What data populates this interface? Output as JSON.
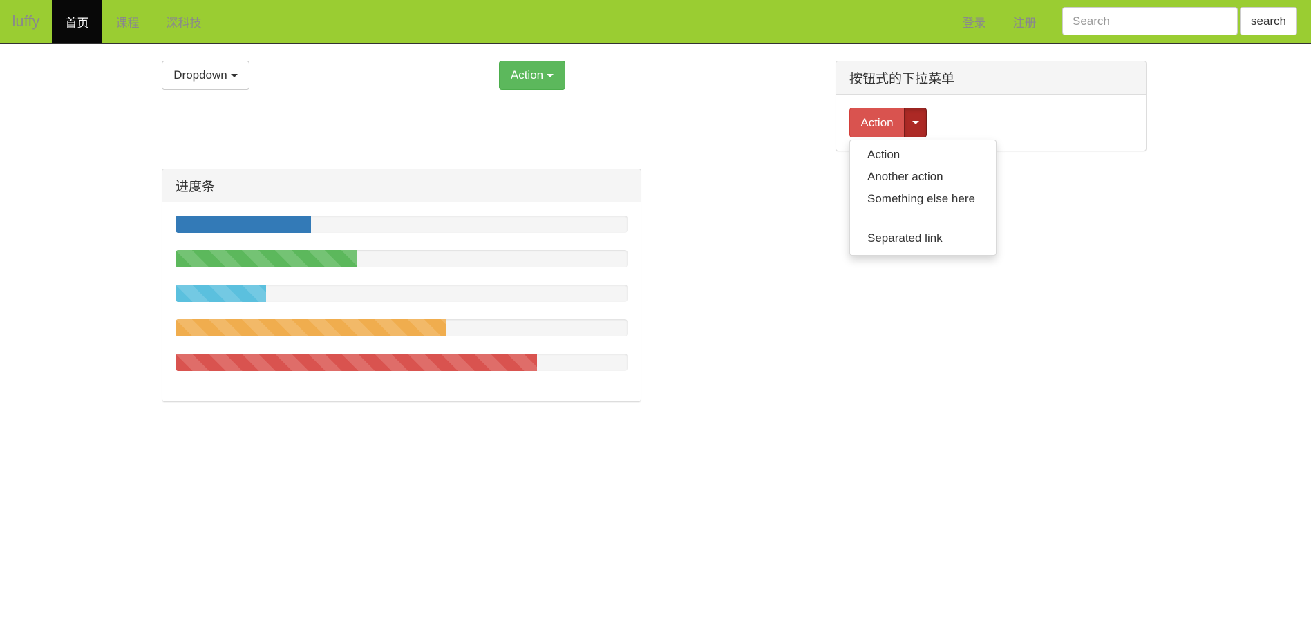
{
  "navbar": {
    "brand": "luffy",
    "items": [
      {
        "label": "首页",
        "active": true
      },
      {
        "label": "课程",
        "active": false
      },
      {
        "label": "深科技",
        "active": false
      }
    ],
    "right_items": [
      {
        "label": "登录"
      },
      {
        "label": "注册"
      }
    ],
    "search_placeholder": "Search",
    "search_button": "search",
    "color": "#9acd32"
  },
  "buttons": {
    "dropdown_label": "Dropdown",
    "action_label": "Action"
  },
  "split_panel": {
    "title": "按钮式的下拉菜单",
    "button_label": "Action",
    "menu": {
      "items": [
        "Action",
        "Another action",
        "Something else here"
      ],
      "separated_item": "Separated link"
    }
  },
  "progress_panel": {
    "title": "进度条",
    "bars": [
      {
        "percent": 30,
        "color": "#337ab7",
        "striped": false
      },
      {
        "percent": 40,
        "color": "#5cb85c",
        "striped": true
      },
      {
        "percent": 20,
        "color": "#5bc0de",
        "striped": true
      },
      {
        "percent": 60,
        "color": "#f0ad4e",
        "striped": true
      },
      {
        "percent": 80,
        "color": "#d9534f",
        "striped": true
      }
    ]
  }
}
